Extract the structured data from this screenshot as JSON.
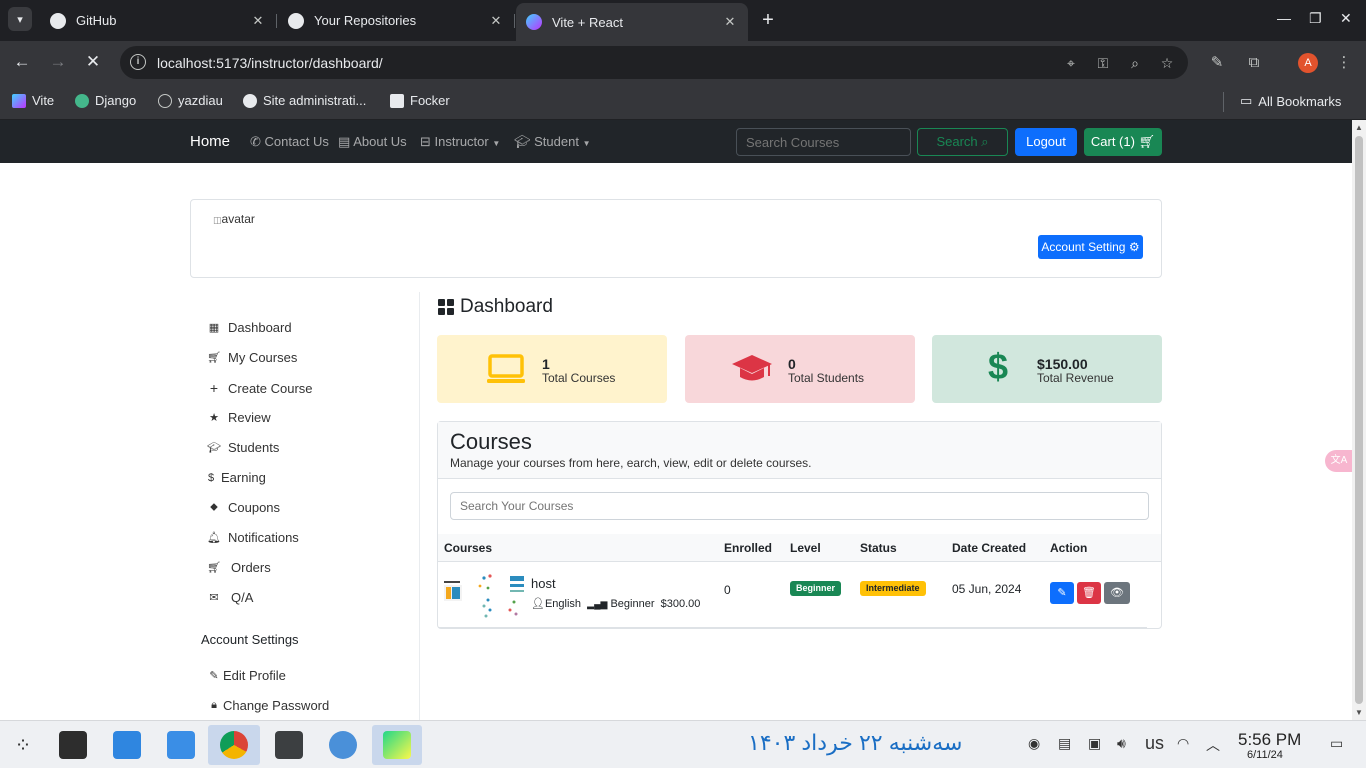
{
  "browser": {
    "tabs": [
      {
        "title": "GitHub"
      },
      {
        "title": "Your Repositories"
      },
      {
        "title": "Vite + React"
      }
    ],
    "url": "localhost:5173/instructor/dashboard/",
    "profile_initial": "A",
    "bookmarks": [
      "Vite",
      "Django",
      "yazdiau",
      "Site administrati...",
      "Focker"
    ],
    "all_bookmarks": "All Bookmarks"
  },
  "site_nav": {
    "brand": "Home",
    "links": [
      "Contact Us",
      "About Us",
      "Instructor",
      "Student"
    ],
    "search_placeholder": "Search Courses",
    "search_button": "Search",
    "logout_button": "Logout",
    "cart_button": "Cart (1)"
  },
  "profile": {
    "avatar_alt": "avatar",
    "account_setting_button": "Account Setting"
  },
  "sidebar": {
    "items": [
      "Dashboard",
      "My Courses",
      "Create Course",
      "Review",
      "Students",
      "Earning",
      "Coupons",
      "Notifications",
      "Orders",
      "Q/A"
    ],
    "account_heading": "Account Settings",
    "account_items": [
      "Edit Profile",
      "Change Password"
    ]
  },
  "dashboard": {
    "title": "Dashboard",
    "stats": [
      {
        "value": "1",
        "label": "Total Courses",
        "color": "#fff3cd",
        "icon_color": "#ffc107"
      },
      {
        "value": "0",
        "label": "Total Students",
        "color": "#f8d7da",
        "icon_color": "#dc3545"
      },
      {
        "value": "$150.00",
        "label": "Total Revenue",
        "color": "#d1e7dd",
        "icon_color": "#198754"
      }
    ],
    "courses": {
      "title": "Courses",
      "subtitle": "Manage your courses from here, earch, view, edit or delete courses.",
      "search_placeholder": "Search Your Courses",
      "headers": [
        "Courses",
        "Enrolled",
        "Level",
        "Status",
        "Date Created",
        "Action"
      ],
      "rows": [
        {
          "name": "host",
          "language": "English",
          "level_text": "Beginner",
          "price": "$300.00",
          "enrolled": "0",
          "level_badge": "Beginner",
          "status_badge": "Intermediate",
          "date": "05 Jun, 2024"
        }
      ]
    }
  },
  "taskbar": {
    "persian_date": "سه‌شنبه ۲۲ خرداد ۱۴۰۳",
    "keyboard": "us",
    "time": "5:56 PM",
    "date": "6/11/24"
  },
  "colors": {
    "primary": "#0d6efd",
    "success": "#198754",
    "danger": "#dc3545",
    "warning": "#ffc107",
    "navbar": "#212529"
  }
}
